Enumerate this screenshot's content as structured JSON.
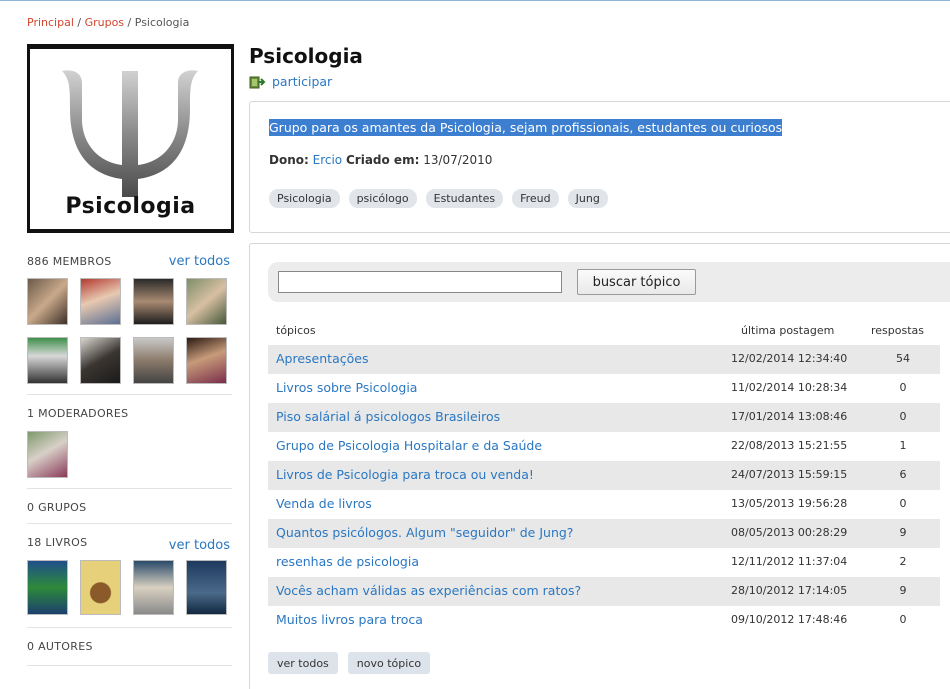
{
  "breadcrumb": {
    "home": "Principal",
    "groups": "Grupos",
    "current": "Psicologia",
    "sep": " / "
  },
  "group": {
    "logo_caption": "Psicologia",
    "title": "Psicologia",
    "join_label": "participar",
    "description": "Grupo para os amantes da Psicologia, sejam profissionais, estudantes ou curiosos",
    "owner_label": "Dono:",
    "owner_name": "Ercio",
    "created_label": "Criado em:",
    "created_date": "13/07/2010",
    "tags": [
      "Psicologia",
      "psicólogo",
      "Estudantes",
      "Freud",
      "Jung"
    ]
  },
  "sidebar": {
    "members": {
      "heading": "886 MEMBROS",
      "more": "ver todos"
    },
    "moderators": {
      "heading": "1 MODERADORES"
    },
    "groups": {
      "heading": "0 GRUPOS"
    },
    "books": {
      "heading": "18 LIVROS",
      "more": "ver todos"
    },
    "authors": {
      "heading": "0 AUTORES"
    }
  },
  "topics": {
    "search_placeholder": "",
    "search_button": "buscar tópico",
    "col_topics": "tópicos",
    "col_last_post": "última postagem",
    "col_replies": "respostas",
    "rows": [
      {
        "title": "Apresentações",
        "date": "12/02/2014 12:34:40",
        "replies": "54"
      },
      {
        "title": "Livros sobre Psicologia",
        "date": "11/02/2014 10:28:34",
        "replies": "0"
      },
      {
        "title": "Piso salárial á psicologos Brasileiros",
        "date": "17/01/2014 13:08:46",
        "replies": "0"
      },
      {
        "title": "Grupo de Psicologia Hospitalar e da Saúde",
        "date": "22/08/2013 15:21:55",
        "replies": "1"
      },
      {
        "title": "Livros de Psicologia para troca ou venda!",
        "date": "24/07/2013 15:59:15",
        "replies": "6"
      },
      {
        "title": "Venda de livros",
        "date": "13/05/2013 19:56:28",
        "replies": "0"
      },
      {
        "title": "Quantos psicólogos. Algum \"seguidor\" de Jung?",
        "date": "08/05/2013 00:28:29",
        "replies": "9"
      },
      {
        "title": "resenhas de psicologia",
        "date": "12/11/2012 11:37:04",
        "replies": "2"
      },
      {
        "title": "Vocês acham válidas as experiências com ratos?",
        "date": "28/10/2012 17:14:05",
        "replies": "9"
      },
      {
        "title": "Muitos livros para troca",
        "date": "09/10/2012 17:48:46",
        "replies": "0"
      }
    ],
    "view_all": "ver todos",
    "new_topic": "novo tópico"
  }
}
